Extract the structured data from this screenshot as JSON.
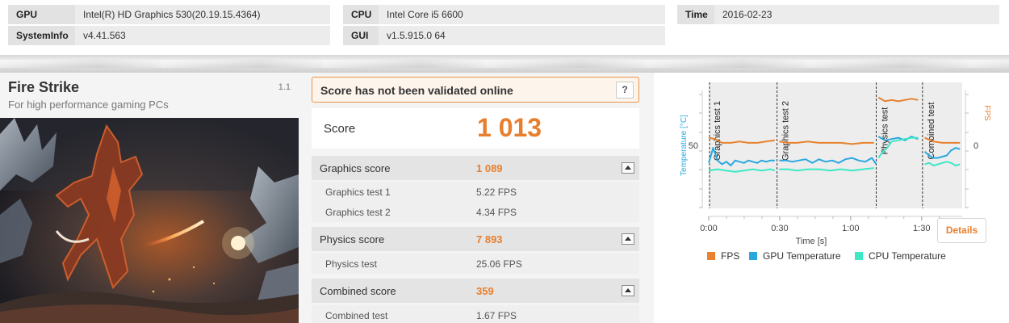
{
  "system": {
    "gpu_label": "GPU",
    "gpu_value": "Intel(R) HD Graphics 530(20.19.15.4364)",
    "cpu_label": "CPU",
    "cpu_value": "Intel Core i5 6600",
    "time_label": "Time",
    "time_value": "2016-02-23",
    "sysinfo_label": "SystemInfo",
    "sysinfo_value": "v4.41.563",
    "gui_label": "GUI",
    "gui_value": "v1.5.915.0 64"
  },
  "test": {
    "title": "Fire Strike",
    "subtitle": "For high performance gaming PCs",
    "version": "1.1"
  },
  "result": {
    "validation_message": "Score has not been validated online",
    "help_label": "?",
    "score_label": "Score",
    "score_value": "1 013",
    "sections": [
      {
        "label": "Graphics score",
        "value": "1 089",
        "rows": [
          {
            "label": "Graphics test 1",
            "value": "5.22 FPS"
          },
          {
            "label": "Graphics test 2",
            "value": "4.34 FPS"
          }
        ]
      },
      {
        "label": "Physics score",
        "value": "7 893",
        "rows": [
          {
            "label": "Physics test",
            "value": "25.06 FPS"
          }
        ]
      },
      {
        "label": "Combined score",
        "value": "359",
        "rows": [
          {
            "label": "Combined test",
            "value": "1.67 FPS"
          }
        ]
      }
    ]
  },
  "monitor": {
    "details_label": "Details",
    "colors": {
      "fps": "#e8822e",
      "gpu_temp": "#29a8e0",
      "cpu_temp": "#3de8c6",
      "accent": "#e87f2e"
    },
    "chart_data": {
      "type": "line",
      "xlabel": "Time [s]",
      "ylabel_left": "Temperature [°C]",
      "ylabel_right": "FPS",
      "x_ticks": [
        "0:00",
        "0:30",
        "1:00",
        "1:30"
      ],
      "left_ticks": [
        {
          "value": 50,
          "label": "50"
        }
      ],
      "right_ticks": [
        {
          "value": 0,
          "label": "0"
        }
      ],
      "xlim": [
        0,
        115
      ],
      "ylim_left": [
        0,
        100
      ],
      "ylim_right": [
        -50,
        50
      ],
      "phases": [
        {
          "label": "Graphics test 1",
          "start": 0,
          "end": 31
        },
        {
          "label": "Graphics test 2",
          "start": 31,
          "end": 76
        },
        {
          "label": "Physics test",
          "start": 76,
          "end": 97
        },
        {
          "label": "Combined test",
          "start": 97,
          "end": 115
        }
      ],
      "series": [
        {
          "name": "FPS",
          "axis": "right",
          "segments": [
            {
              "x": [
                0,
                3,
                6,
                10,
                14,
                18,
                22,
                26,
                30
              ],
              "y": [
                6,
                5,
                2,
                2,
                3,
                2,
                2,
                3,
                4
              ]
            },
            {
              "x": [
                32,
                36,
                40,
                45,
                50,
                55,
                60,
                65,
                70,
                75
              ],
              "y": [
                3,
                2,
                2,
                3,
                2,
                2,
                2,
                1,
                2,
                2
              ]
            },
            {
              "x": [
                77,
                80,
                83,
                86,
                89,
                92,
                95
              ],
              "y": [
                38,
                35,
                36,
                35,
                36,
                37,
                36
              ]
            },
            {
              "x": [
                98,
                102,
                106,
                110,
                114
              ],
              "y": [
                6,
                3,
                2,
                2,
                2
              ]
            }
          ]
        },
        {
          "name": "GPU Temperature",
          "axis": "left",
          "segments": [
            {
              "x": [
                0,
                2,
                4,
                6,
                8,
                10,
                12,
                14,
                16,
                18,
                20,
                22,
                24,
                26,
                28,
                30
              ],
              "y": [
                36,
                48,
                38,
                35,
                37,
                34,
                38,
                37,
                36,
                38,
                37,
                36,
                38,
                37,
                38,
                38
              ]
            },
            {
              "x": [
                32,
                35,
                38,
                41,
                44,
                47,
                50,
                53,
                56,
                59,
                62,
                65,
                68,
                71,
                74,
                76
              ],
              "y": [
                38,
                38,
                37,
                38,
                39,
                36,
                39,
                37,
                38,
                36,
                39,
                40,
                38,
                37,
                40,
                35
              ]
            },
            {
              "x": [
                77,
                80,
                83,
                86,
                89,
                92,
                95
              ],
              "y": [
                57,
                54,
                55,
                56,
                54,
                57,
                55
              ]
            },
            {
              "x": [
                98,
                100,
                102,
                104,
                106,
                108,
                110,
                112,
                114
              ],
              "y": [
                45,
                42,
                40,
                40,
                41,
                42,
                46,
                48,
                47
              ]
            }
          ]
        },
        {
          "name": "CPU Temperature",
          "axis": "left",
          "segments": [
            {
              "x": [
                0,
                4,
                8,
                12,
                16,
                20,
                24,
                28,
                30
              ],
              "y": [
                30,
                31,
                30,
                29,
                30,
                31,
                30,
                31,
                30
              ]
            },
            {
              "x": [
                32,
                36,
                40,
                45,
                50,
                55,
                60,
                65,
                70,
                75
              ],
              "y": [
                31,
                31,
                30,
                31,
                31,
                30,
                31,
                30,
                31,
                32
              ]
            },
            {
              "x": [
                77,
                79,
                81,
                83,
                86,
                89,
                92,
                95
              ],
              "y": [
                40,
                45,
                48,
                53,
                54,
                55,
                56,
                56
              ]
            },
            {
              "x": [
                98,
                100,
                102,
                104,
                106,
                108,
                110,
                112,
                114
              ],
              "y": [
                35,
                36,
                34,
                35,
                36,
                37,
                36,
                34,
                35
              ]
            }
          ]
        }
      ]
    }
  }
}
